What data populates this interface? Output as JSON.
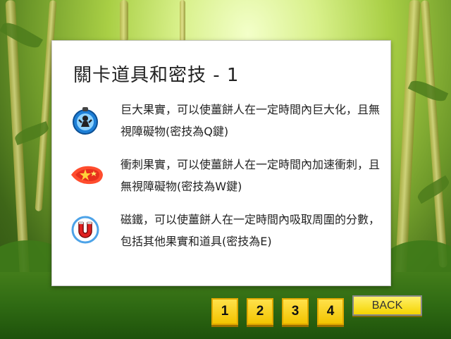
{
  "panel": {
    "title": "關卡道具和密技 - 1",
    "items": [
      {
        "icon": "giant-fruit-icon",
        "text": "巨大果實，可以使薑餅人在一定時間內巨大化，且無視障礙物(密技為Q鍵)"
      },
      {
        "icon": "dash-fruit-icon",
        "text": "衝刺果實，可以使薑餅人在一定時間內加速衝刺，且無視障礙物(密技為W鍵)"
      },
      {
        "icon": "magnet-icon",
        "text": "磁鐵，可以使薑餅人在一定時間內吸取周圍的分數，包括其他果實和道具(密技為E)"
      }
    ]
  },
  "pagination": {
    "pages": [
      "1",
      "2",
      "3",
      "4"
    ],
    "current": "1"
  },
  "back_label": "BACK"
}
